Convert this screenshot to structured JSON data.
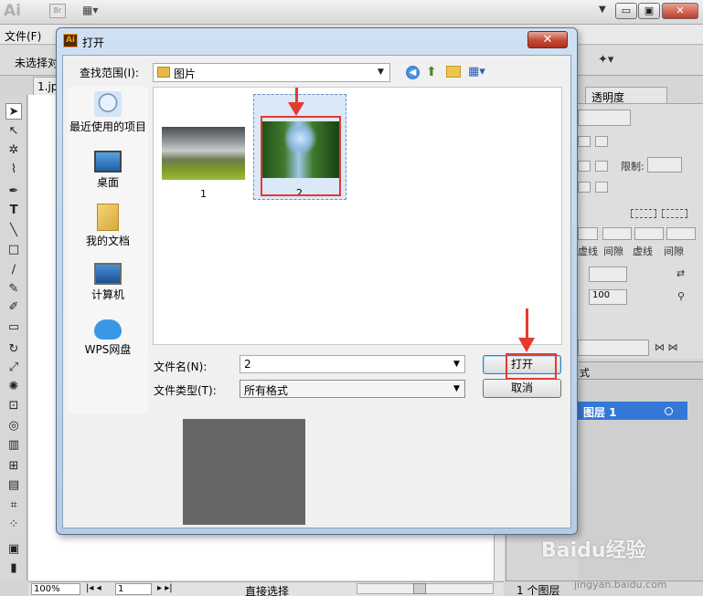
{
  "app": {
    "logo_text": "Ai",
    "bridge_label": "Br",
    "arrange_icon": "▦▾",
    "workspace_drop": "▼",
    "min_label": "▭",
    "restore_label": "▣",
    "close_label": "✕",
    "menu_file": "文件(F)",
    "no_selection": "未选择对",
    "doc_tab": "1.jp",
    "zoom": "100%",
    "page": "1",
    "tool_status": "直接选择",
    "transparency_tab": "透明度",
    "limit_label": "限制:",
    "dash_labels": [
      "虚线",
      "间隙",
      "虚线",
      "间隙"
    ],
    "pct_100": "100",
    "tab_fragment": "式",
    "layer_name": "图层 1",
    "layers_count": "1 个图层"
  },
  "dialog": {
    "title": "打开",
    "close_label": "✕",
    "lookin_label": "查找范围(I):",
    "lookin_value": "图片",
    "places": [
      {
        "label": "最近使用的项目",
        "icon": "recent-items-icon"
      },
      {
        "label": "桌面",
        "icon": "desktop-icon"
      },
      {
        "label": "我的文档",
        "icon": "my-documents-icon"
      },
      {
        "label": "计算机",
        "icon": "computer-icon"
      },
      {
        "label": "WPS网盘",
        "icon": "wps-cloud-icon"
      }
    ],
    "files": [
      {
        "label": "1"
      },
      {
        "label": "2"
      }
    ],
    "filename_label": "文件名(N):",
    "filename_value": "2",
    "filetype_label": "文件类型(T):",
    "filetype_value": "所有格式",
    "open_button": "打开",
    "cancel_button": "取消"
  },
  "watermark": {
    "brand": "Baidu经验",
    "url": "jingyan.baidu.com"
  },
  "colors": {
    "highlight_red": "#e53a2e",
    "layer_selected": "#3478d7",
    "dialog_frame": "#b4cde6"
  }
}
